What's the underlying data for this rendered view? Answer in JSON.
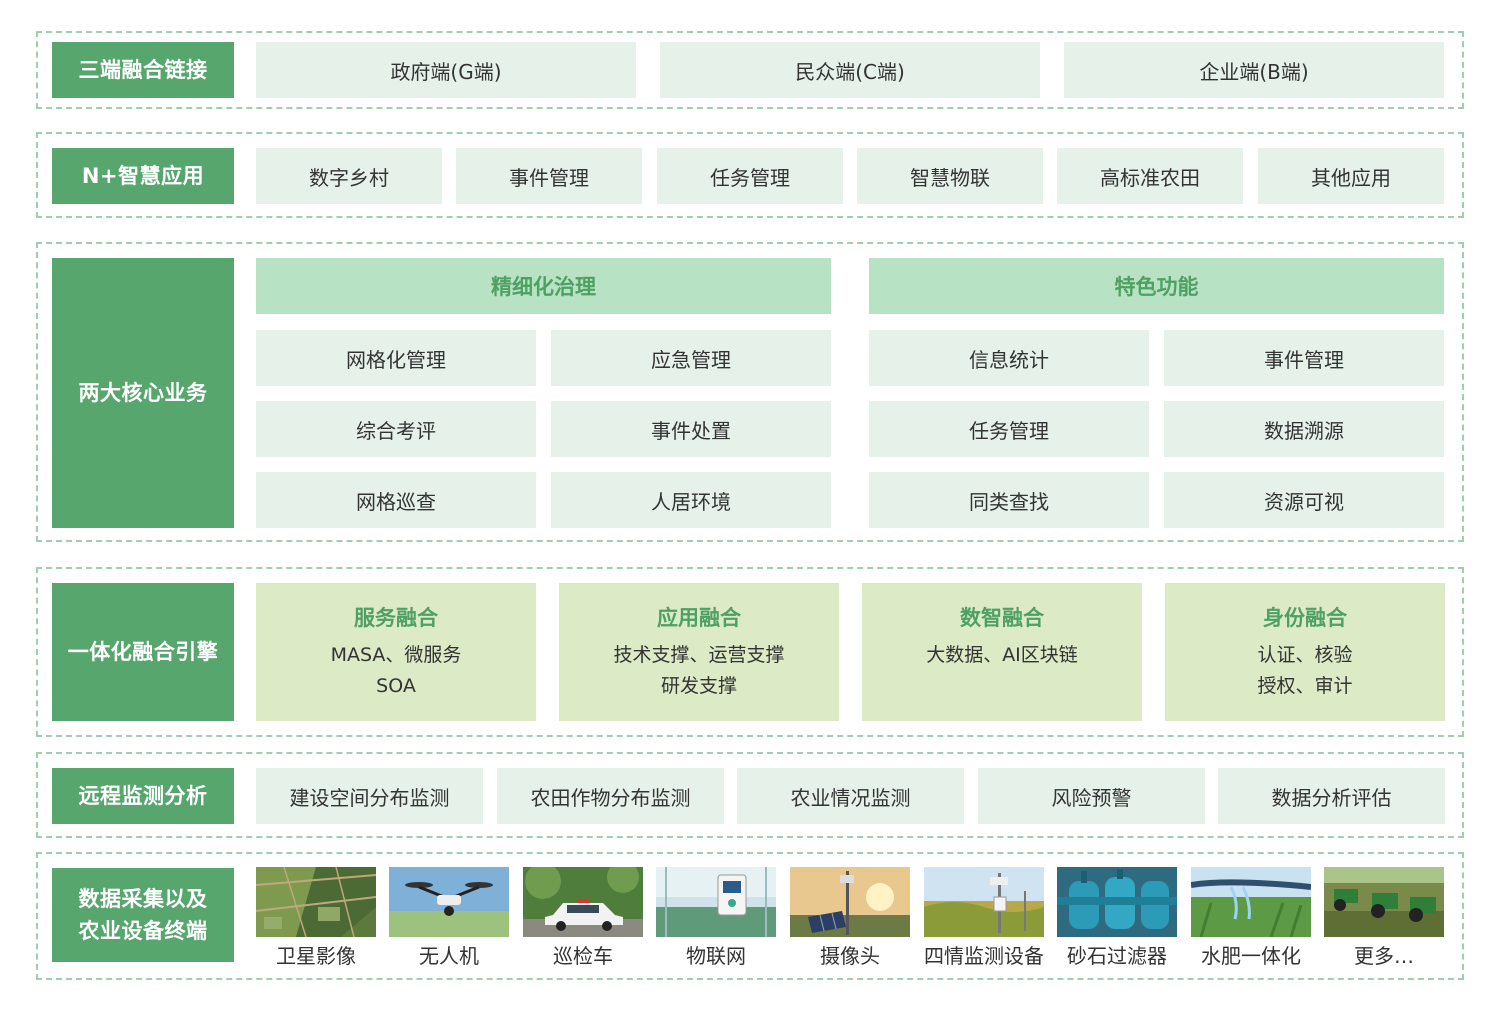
{
  "rows": {
    "terminals": {
      "label": "三端融合链接",
      "items": [
        "政府端(G端)",
        "民众端(C端)",
        "企业端(B端)"
      ]
    },
    "apps": {
      "label": "N+智慧应用",
      "items": [
        "数字乡村",
        "事件管理",
        "任务管理",
        "智慧物联",
        "高标准农田",
        "其他应用"
      ]
    },
    "core": {
      "label": "两大核心业务",
      "groups": [
        {
          "title": "精细化治理",
          "items": [
            "网格化管理",
            "应急管理",
            "综合考评",
            "事件处置",
            "网格巡查",
            "人居环境"
          ]
        },
        {
          "title": "特色功能",
          "items": [
            "信息统计",
            "事件管理",
            "任务管理",
            "数据溯源",
            "同类查找",
            "资源可视"
          ]
        }
      ]
    },
    "engine": {
      "label": "一体化融合引擎",
      "items": [
        {
          "title": "服务融合",
          "line1": "MASA、微服务",
          "line2": "SOA"
        },
        {
          "title": "应用融合",
          "line1": "技术支撑、运营支撑",
          "line2": "研发支撑"
        },
        {
          "title": "数智融合",
          "line1": "大数据、AI区块链",
          "line2": ""
        },
        {
          "title": "身份融合",
          "line1": "认证、核验",
          "line2": "授权、审计"
        }
      ]
    },
    "monitor": {
      "label": "远程监测分析",
      "items": [
        "建设空间分布监测",
        "农田作物分布监测",
        "农业情况监测",
        "风险预警",
        "数据分析评估"
      ]
    },
    "devices": {
      "label_line1": "数据采集以及",
      "label_line2": "农业设备终端",
      "items": [
        {
          "caption": "卫星影像",
          "icon": "satellite-image-icon"
        },
        {
          "caption": "无人机",
          "icon": "drone-icon"
        },
        {
          "caption": "巡检车",
          "icon": "patrol-car-icon"
        },
        {
          "caption": "物联网",
          "icon": "iot-device-icon"
        },
        {
          "caption": "摄像头",
          "icon": "camera-solar-icon"
        },
        {
          "caption": "四情监测设备",
          "icon": "monitoring-station-icon"
        },
        {
          "caption": "砂石过滤器",
          "icon": "sand-filter-icon"
        },
        {
          "caption": "水肥一体化",
          "icon": "fertigation-icon"
        },
        {
          "caption": "更多…",
          "icon": "tractors-icon"
        }
      ]
    }
  }
}
